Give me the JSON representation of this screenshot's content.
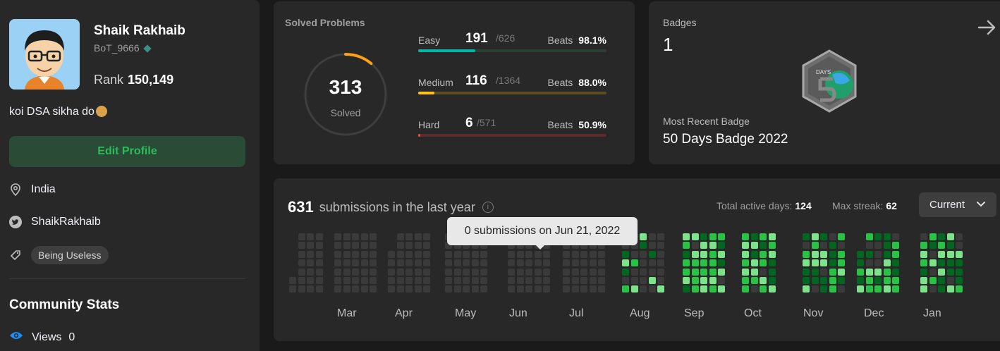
{
  "profile": {
    "name": "Shaik Rakhaib",
    "handle": "BoT_9666",
    "rank_label": "Rank",
    "rank_value": "150,149",
    "bio": "koi DSA sikha do",
    "edit_label": "Edit Profile",
    "location": "India",
    "twitter": "ShaikRakhaib",
    "tag": "Being Useless",
    "community_title": "Community Stats",
    "views_label": "Views",
    "views_value": "0"
  },
  "solved": {
    "title": "Solved Problems",
    "total": "313",
    "total_label": "Solved",
    "ring_color": "#ffa116",
    "rows": [
      {
        "label": "Easy",
        "solved": "191",
        "total": "/626",
        "beats_label": "Beats",
        "beats": "98.1%",
        "fill": 0.305,
        "color": "#00b8a3",
        "track": "#2a4035"
      },
      {
        "label": "Medium",
        "solved": "116",
        "total": "/1364",
        "beats_label": "Beats",
        "beats": "88.0%",
        "fill": 0.085,
        "color": "#ffc01e",
        "track": "#5a4d22"
      },
      {
        "label": "Hard",
        "solved": "6",
        "total": "/571",
        "beats_label": "Beats",
        "beats": "50.9%",
        "fill": 0.011,
        "color": "#ef4743",
        "track": "#5a2c2b"
      }
    ]
  },
  "badges": {
    "title": "Badges",
    "count": "1",
    "recent_label": "Most Recent Badge",
    "recent_name": "50 Days Badge 2022",
    "badge_icon": "50-days-badge-icon",
    "badge_text": "DAYS"
  },
  "calendar": {
    "count": "631",
    "label": "submissions in the last year",
    "active_label": "Total active days:",
    "active_value": "124",
    "streak_label": "Max streak:",
    "streak_value": "62",
    "dropdown": "Current",
    "tooltip": "0 submissions on Jun 21, 2022",
    "months": [
      "Mar",
      "Apr",
      "May",
      "Jun",
      "Jul",
      "Aug",
      "Sep",
      "Oct",
      "Nov",
      "Dec",
      "Jan"
    ],
    "colors": {
      "empty": "#3a3a3a",
      "l1": "#016620",
      "l2": "#28c244",
      "l3": "#7ce38b"
    }
  }
}
